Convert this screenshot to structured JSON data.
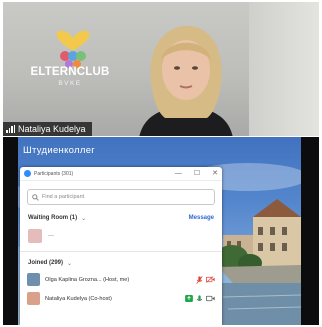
{
  "top_video": {
    "brand": {
      "name": "ELTERNCLUB",
      "sub": "BVKE"
    },
    "participant_name": "Nataliya Kudelya",
    "icons": {
      "signal": "signal-bars-icon"
    }
  },
  "shared_screen": {
    "desktop_title": "Штудиенколлег",
    "participants_window": {
      "title": "Participants (301)",
      "search_placeholder": "Find a participant",
      "waiting_room": {
        "header": "Waiting Room (1)",
        "message_label": "Message",
        "entries": [
          {
            "name": "—",
            "avatar_color": "#e5bcbc"
          }
        ]
      },
      "joined": {
        "header": "Joined (299)",
        "entries": [
          {
            "name": "Olga Kaplina Grozna... (Host, me)",
            "avatar_color": "#6f8fae",
            "icons": [
              "mic-muted-icon",
              "video-off-icon"
            ]
          },
          {
            "name": "Nataliya Kudelya (Co-host)",
            "avatar_color": "#d9a08a",
            "icons": [
              "share-screen-icon",
              "mic-icon",
              "video-icon"
            ]
          }
        ]
      }
    }
  },
  "colors": {
    "accent": "#2d8cff",
    "muted_red": "#e0433b",
    "share_green": "#1fa64a"
  }
}
